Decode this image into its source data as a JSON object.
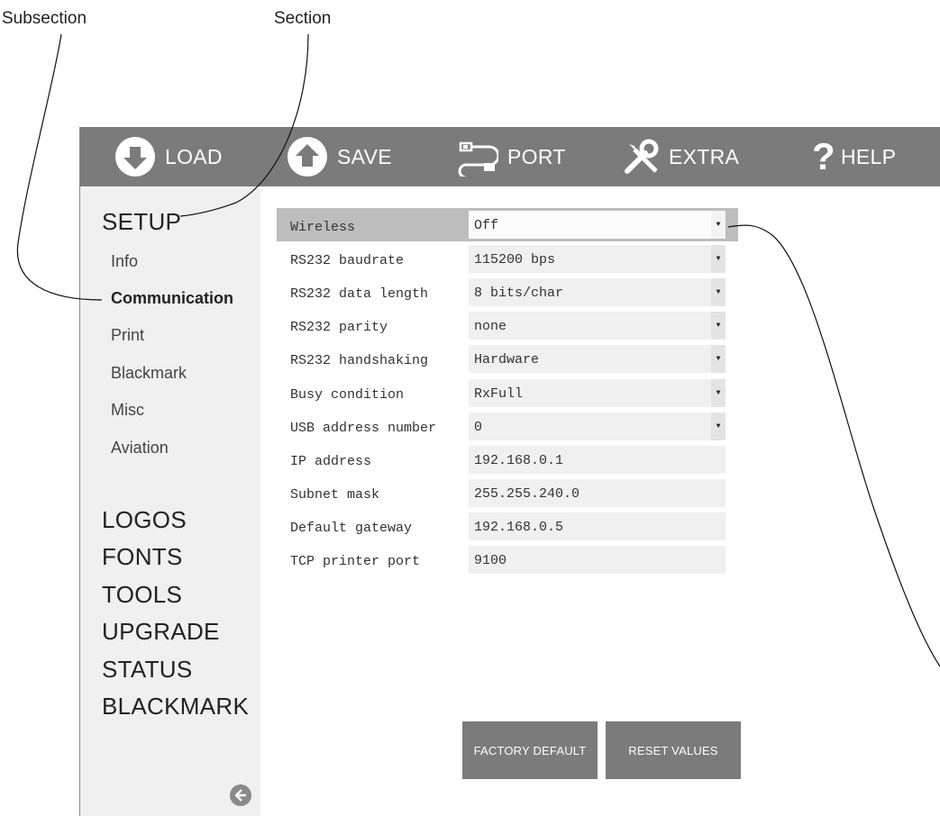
{
  "callouts": {
    "subsection": "Subsection",
    "section": "Section"
  },
  "toolbar": {
    "load": "LOAD",
    "save": "SAVE",
    "port": "PORT",
    "extra": "EXTRA",
    "help": "HELP"
  },
  "sidebar": {
    "setup": "SETUP",
    "subsections": [
      "Info",
      "Communication",
      "Print",
      "Blackmark",
      "Misc",
      "Aviation"
    ],
    "active_subsection": "Communication",
    "sections": [
      "LOGOS",
      "FONTS",
      "TOOLS",
      "UPGRADE",
      "STATUS",
      "BLACKMARK"
    ]
  },
  "form": {
    "rows": [
      {
        "label": "Wireless",
        "value": "Off",
        "dropdown": true
      },
      {
        "label": "RS232 baudrate",
        "value": "115200 bps",
        "dropdown": true
      },
      {
        "label": "RS232 data length",
        "value": "8 bits/char",
        "dropdown": true
      },
      {
        "label": "RS232 parity",
        "value": "none",
        "dropdown": true
      },
      {
        "label": "RS232 handshaking",
        "value": "Hardware",
        "dropdown": true
      },
      {
        "label": "Busy condition",
        "value": "RxFull",
        "dropdown": true
      },
      {
        "label": "USB address number",
        "value": "0",
        "dropdown": true
      },
      {
        "label": "IP address",
        "value": "192.168.0.1",
        "dropdown": false
      },
      {
        "label": "Subnet mask",
        "value": "255.255.240.0",
        "dropdown": false
      },
      {
        "label": "Default gateway",
        "value": "192.168.0.5",
        "dropdown": false
      },
      {
        "label": "TCP printer port",
        "value": "9100",
        "dropdown": false
      }
    ]
  },
  "buttons": {
    "factory_default": "FACTORY DEFAULT",
    "reset_values": "RESET VALUES"
  },
  "icons": {
    "load": "arrow-down-circle-icon",
    "save": "arrow-up-circle-icon",
    "port": "usb-cable-icon",
    "extra": "tools-icon",
    "help": "question-mark-icon",
    "dropdown": "triangle-down-icon",
    "back": "arrow-left-circle-icon"
  },
  "colors": {
    "toolbar": "#7b7b7b",
    "sidebar": "#f0f0f1",
    "highlight_row": "#bdbdbd",
    "button": "#7b7b7b"
  }
}
